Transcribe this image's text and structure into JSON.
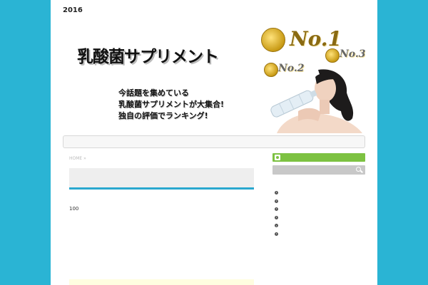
{
  "header": {
    "year": "2016",
    "banner_title": "乳酸菌サプリメント",
    "banner_tagline": [
      "今話題を集めている",
      "乳酸菌サプリメントが大集合!",
      "独自の評価でランキング!"
    ],
    "badges": [
      "No.1",
      "No.2",
      "No.3"
    ]
  },
  "main": {
    "breadcrumb": "HOME »",
    "body_number": "100"
  },
  "sidebar": {
    "list_count": 6
  },
  "colors": {
    "background": "#2ab4d4",
    "accent_blue": "#29a8cf",
    "rss_green": "#7dc242",
    "search_grey": "#c8c8c8"
  },
  "icons": {
    "rss": "rss-icon",
    "search": "search-icon",
    "bullet": "arrow-bullet-icon"
  }
}
